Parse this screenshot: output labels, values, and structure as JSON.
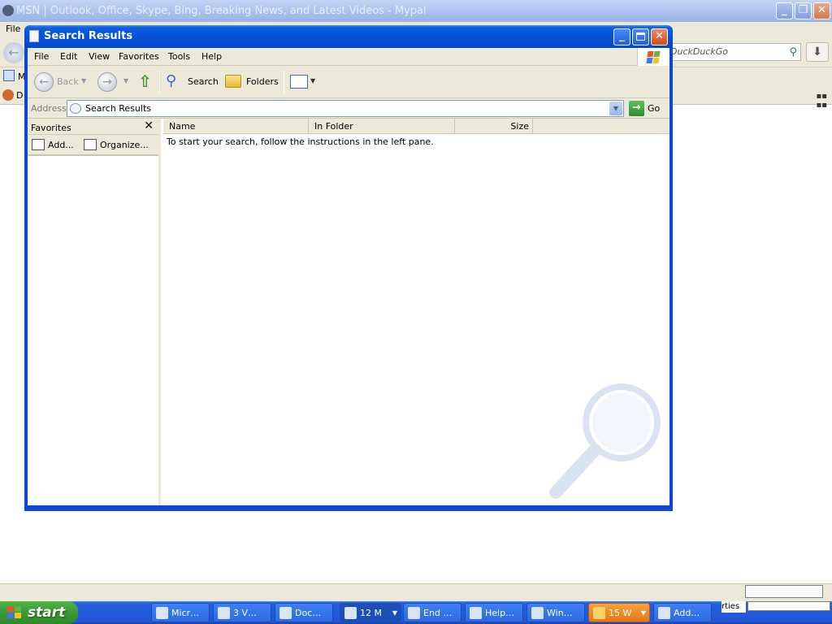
{
  "background_browser": {
    "title": "MSN | Outlook, Office, Skype, Bing, Breaking News, and Latest Videos - Mypal",
    "menu_first": "File",
    "search_placeholder": "DuckDuckGo",
    "bookmark_fragment": "M",
    "tab_fragment": "D",
    "status_fragment": "rties"
  },
  "window": {
    "title": "Search Results",
    "menu": [
      "File",
      "Edit",
      "View",
      "Favorites",
      "Tools",
      "Help"
    ],
    "toolbar": {
      "back": "Back",
      "search": "Search",
      "folders": "Folders"
    },
    "address": {
      "label": "Address",
      "value": "Search Results",
      "go": "Go"
    },
    "favorites_pane": {
      "title": "Favorites",
      "add": "Add...",
      "organize": "Organize..."
    },
    "columns": [
      "Name",
      "In Folder",
      "Size"
    ],
    "message": "To start your search, follow the instructions in the left pane."
  },
  "taskbar": {
    "start_label": "start",
    "tasks": [
      "Micr…",
      "3 V…",
      "Doc…",
      "12 M",
      "End …",
      "Help…",
      "Win…",
      "15 W",
      "Add…"
    ]
  },
  "colors": {
    "xp_blue": "#0a49d8",
    "taskbar_blue": "#245edb",
    "start_green": "#3a9a36",
    "active_task_orange": "#e5781a"
  }
}
